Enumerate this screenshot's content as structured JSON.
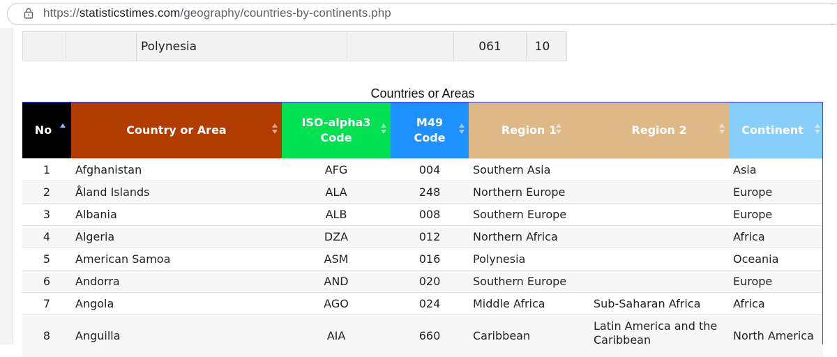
{
  "browser": {
    "url_scheme": "https://",
    "url_domain": "statisticstimes.com",
    "url_path": "/geography/countries-by-continents.php"
  },
  "prev_table_row": {
    "col3": "Polynesia",
    "col5": "061",
    "col6": "10"
  },
  "table": {
    "caption": "Countries or Areas",
    "headers": [
      {
        "label": "No",
        "color": "#000000",
        "sort": "asc"
      },
      {
        "label": "Country or Area",
        "color": "#b23c00",
        "sort": "none"
      },
      {
        "label": "ISO-alpha3 Code",
        "line1": "ISO-alpha3",
        "line2": "Code",
        "color": "#00e050",
        "sort": "none"
      },
      {
        "label": "M49 Code",
        "line1": "M49",
        "line2": "Code",
        "color": "#1e90ff",
        "sort": "none"
      },
      {
        "label": "Region 1",
        "color": "#deb887",
        "sort": "none"
      },
      {
        "label": "Region 2",
        "color": "#deb887",
        "sort": "none"
      },
      {
        "label": "Continent",
        "color": "#87cefa",
        "sort": "none"
      }
    ],
    "rows": [
      {
        "no": "1",
        "country": "Afghanistan",
        "iso": "AFG",
        "m49": "004",
        "region1": "Southern Asia",
        "region2": "",
        "continent": "Asia"
      },
      {
        "no": "2",
        "country": "Åland Islands",
        "iso": "ALA",
        "m49": "248",
        "region1": "Northern Europe",
        "region2": "",
        "continent": "Europe"
      },
      {
        "no": "3",
        "country": "Albania",
        "iso": "ALB",
        "m49": "008",
        "region1": "Southern Europe",
        "region2": "",
        "continent": "Europe"
      },
      {
        "no": "4",
        "country": "Algeria",
        "iso": "DZA",
        "m49": "012",
        "region1": "Northern Africa",
        "region2": "",
        "continent": "Africa"
      },
      {
        "no": "5",
        "country": "American Samoa",
        "iso": "ASM",
        "m49": "016",
        "region1": "Polynesia",
        "region2": "",
        "continent": "Oceania"
      },
      {
        "no": "6",
        "country": "Andorra",
        "iso": "AND",
        "m49": "020",
        "region1": "Southern Europe",
        "region2": "",
        "continent": "Europe"
      },
      {
        "no": "7",
        "country": "Angola",
        "iso": "AGO",
        "m49": "024",
        "region1": "Middle Africa",
        "region2": "Sub-Saharan Africa",
        "continent": "Africa"
      },
      {
        "no": "8",
        "country": "Anguilla",
        "iso": "AIA",
        "m49": "660",
        "region1": "Caribbean",
        "region2": "Latin America and the Caribbean",
        "continent": "North America"
      }
    ]
  }
}
